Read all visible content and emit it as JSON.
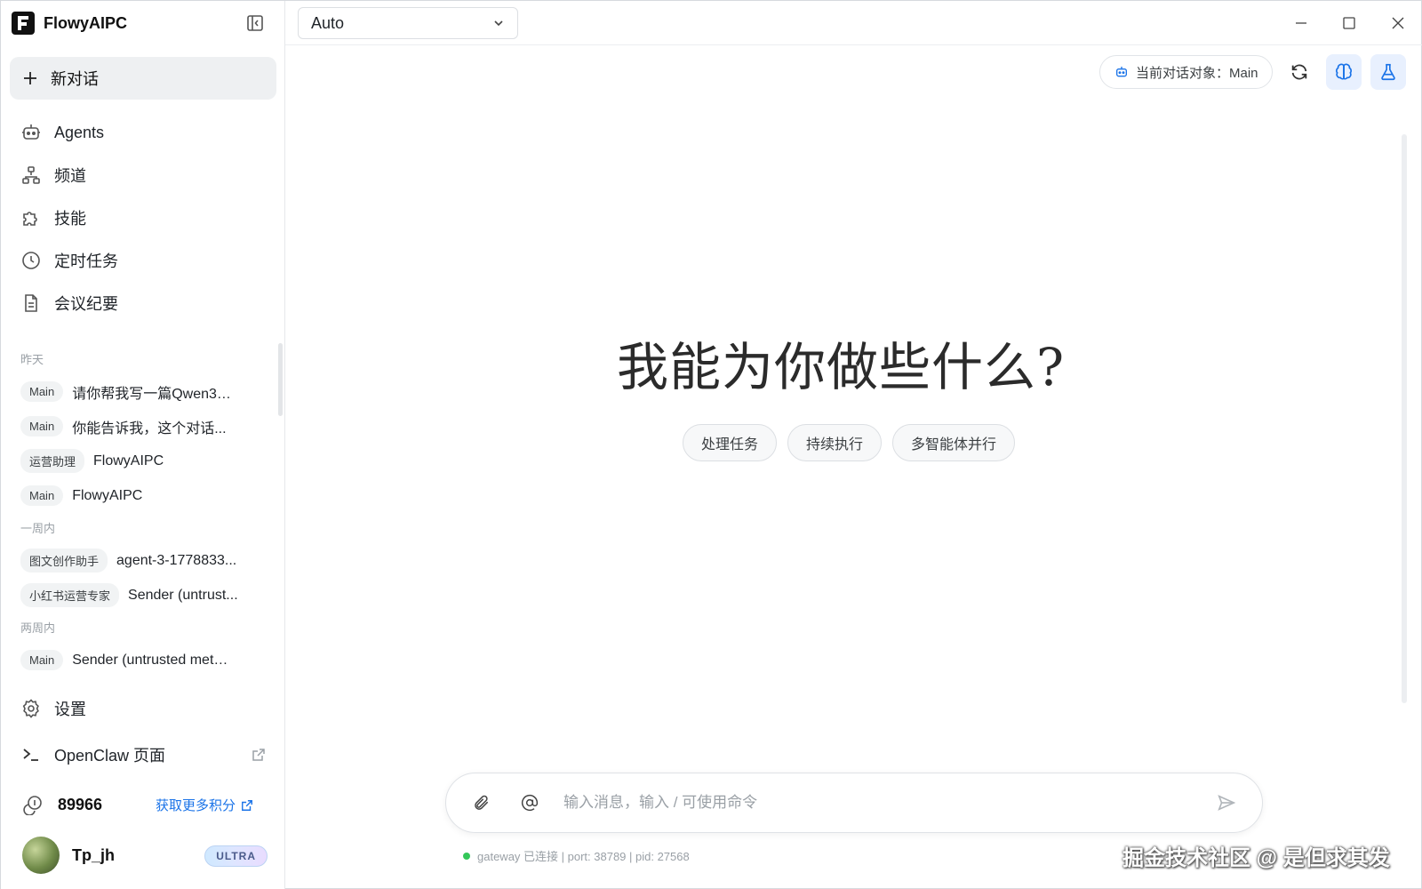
{
  "app": {
    "name": "FlowyAIPC"
  },
  "sidebar": {
    "new_chat_label": "新对话",
    "nav": [
      {
        "label": "Agents",
        "icon": "robot-icon"
      },
      {
        "label": "频道",
        "icon": "channels-icon"
      },
      {
        "label": "技能",
        "icon": "puzzle-icon"
      },
      {
        "label": "定时任务",
        "icon": "clock-icon"
      },
      {
        "label": "会议纪要",
        "icon": "document-icon"
      }
    ],
    "history": {
      "groups": [
        {
          "label": "昨天",
          "items": [
            {
              "tag": "Main",
              "title": "请你帮我写一篇Qwen3...."
            },
            {
              "tag": "Main",
              "title": "你能告诉我，这个对话..."
            },
            {
              "tag": "运营助理",
              "title": "FlowyAIPC"
            },
            {
              "tag": "Main",
              "title": "FlowyAIPC"
            }
          ]
        },
        {
          "label": "一周内",
          "items": [
            {
              "tag": "图文创作助手",
              "title": "agent-3-1778833..."
            },
            {
              "tag": "小红书运营专家",
              "title": "Sender (untrust..."
            }
          ]
        },
        {
          "label": "两周内",
          "items": [
            {
              "tag": "Main",
              "title": "Sender (untrusted meta..."
            }
          ]
        }
      ]
    },
    "settings_label": "设置",
    "openclaw_label": "OpenClaw 页面",
    "credits": {
      "value": "89966",
      "link": "获取更多积分"
    },
    "user": {
      "name": "Tp_jh",
      "plan": "ULTRA"
    }
  },
  "topbar": {
    "model": "Auto"
  },
  "header": {
    "context_label": "当前对话对象：Main"
  },
  "main": {
    "hero": "我能为你做些什么?",
    "chips": [
      "处理任务",
      "持续执行",
      "多智能体并行"
    ]
  },
  "composer": {
    "placeholder": "输入消息，输入 / 可使用命令"
  },
  "status": {
    "text": "gateway 已连接 | port: 38789 | pid: 27568"
  },
  "watermark": "掘金技术社区 @ 是但求其发",
  "colors": {
    "accent": "#1a73e8",
    "status_ok": "#34c759"
  }
}
